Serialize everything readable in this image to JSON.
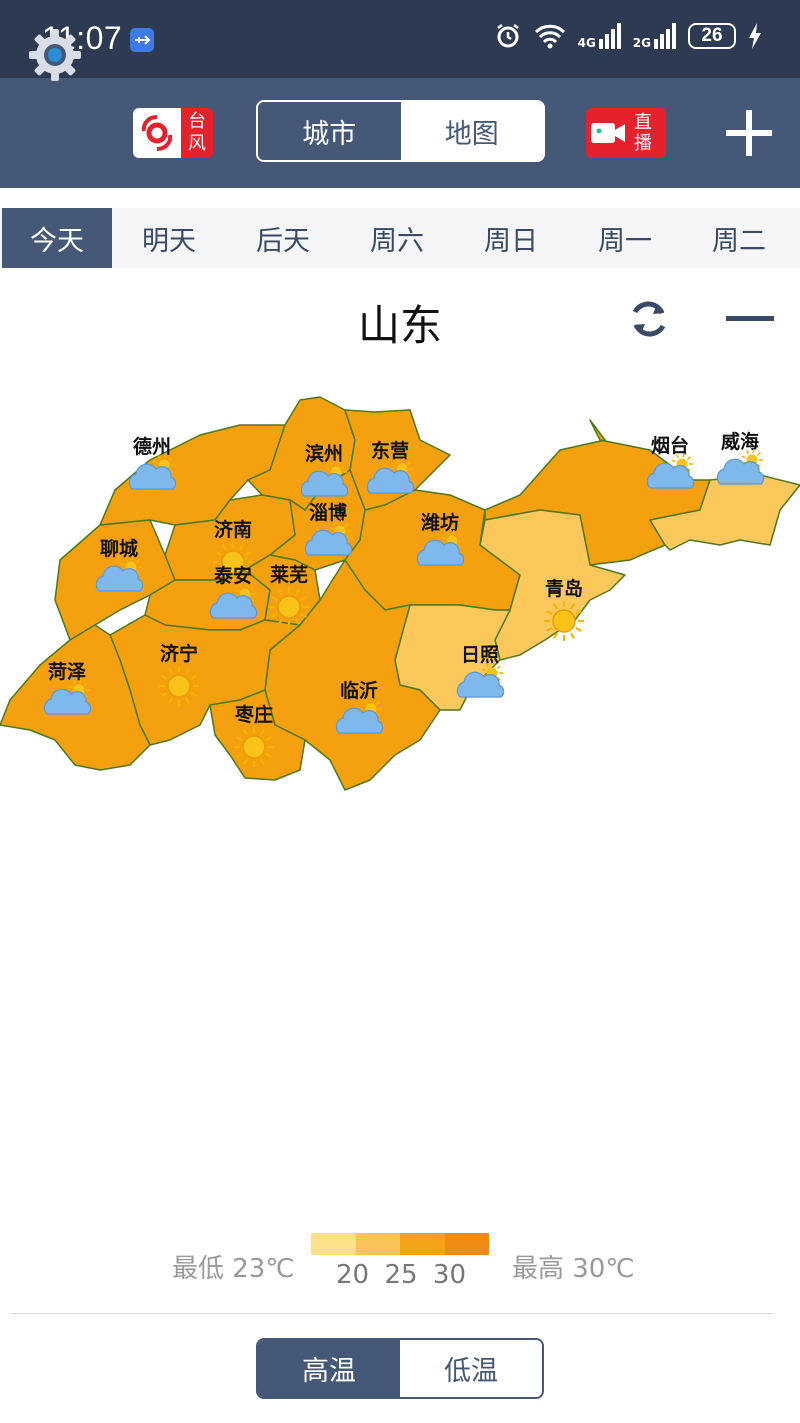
{
  "status_bar": {
    "time": "11:07",
    "battery": "26",
    "net1": "4G",
    "net2": "2G"
  },
  "toolbar": {
    "typhoon_label": "台风",
    "view_toggle": {
      "city": "城市",
      "map": "地图",
      "active": "城市"
    },
    "live_label": "直播"
  },
  "day_tabs": [
    "今天",
    "明天",
    "后天",
    "周六",
    "周日",
    "周一",
    "周二"
  ],
  "province": {
    "name": "山东"
  },
  "map_cities": [
    {
      "name": "德州",
      "weather": "partly-cloudy"
    },
    {
      "name": "滨州",
      "weather": "partly-cloudy"
    },
    {
      "name": "东营",
      "weather": "partly-cloudy"
    },
    {
      "name": "烟台",
      "weather": "partly-cloudy"
    },
    {
      "name": "威海",
      "weather": "partly-cloudy"
    },
    {
      "name": "济南",
      "weather": "sunny"
    },
    {
      "name": "淄博",
      "weather": "partly-cloudy"
    },
    {
      "name": "潍坊",
      "weather": "partly-cloudy"
    },
    {
      "name": "聊城",
      "weather": "partly-cloudy"
    },
    {
      "name": "泰安",
      "weather": "partly-cloudy"
    },
    {
      "name": "莱芜",
      "weather": "sunny"
    },
    {
      "name": "青岛",
      "weather": "sunny"
    },
    {
      "name": "济宁",
      "weather": "sunny"
    },
    {
      "name": "菏泽",
      "weather": "partly-cloudy"
    },
    {
      "name": "日照",
      "weather": "partly-cloudy"
    },
    {
      "name": "临沂",
      "weather": "partly-cloudy"
    },
    {
      "name": "枣庄",
      "weather": "sunny"
    }
  ],
  "legend": {
    "low_label": "最低 23℃",
    "high_label": "最高 30℃",
    "ticks": [
      "20",
      "25",
      "30"
    ],
    "colors": [
      "#fde08a",
      "#fbc45a",
      "#f3a318",
      "#ef8a12"
    ]
  },
  "temp_toggle": {
    "high": "高温",
    "low": "低温",
    "active": "高温"
  },
  "colors": {
    "header": "#465877",
    "status": "#2d3a52",
    "region_hot": "#f5a00f",
    "region_warm": "#fcc85c",
    "accent_red": "#e6212b"
  }
}
